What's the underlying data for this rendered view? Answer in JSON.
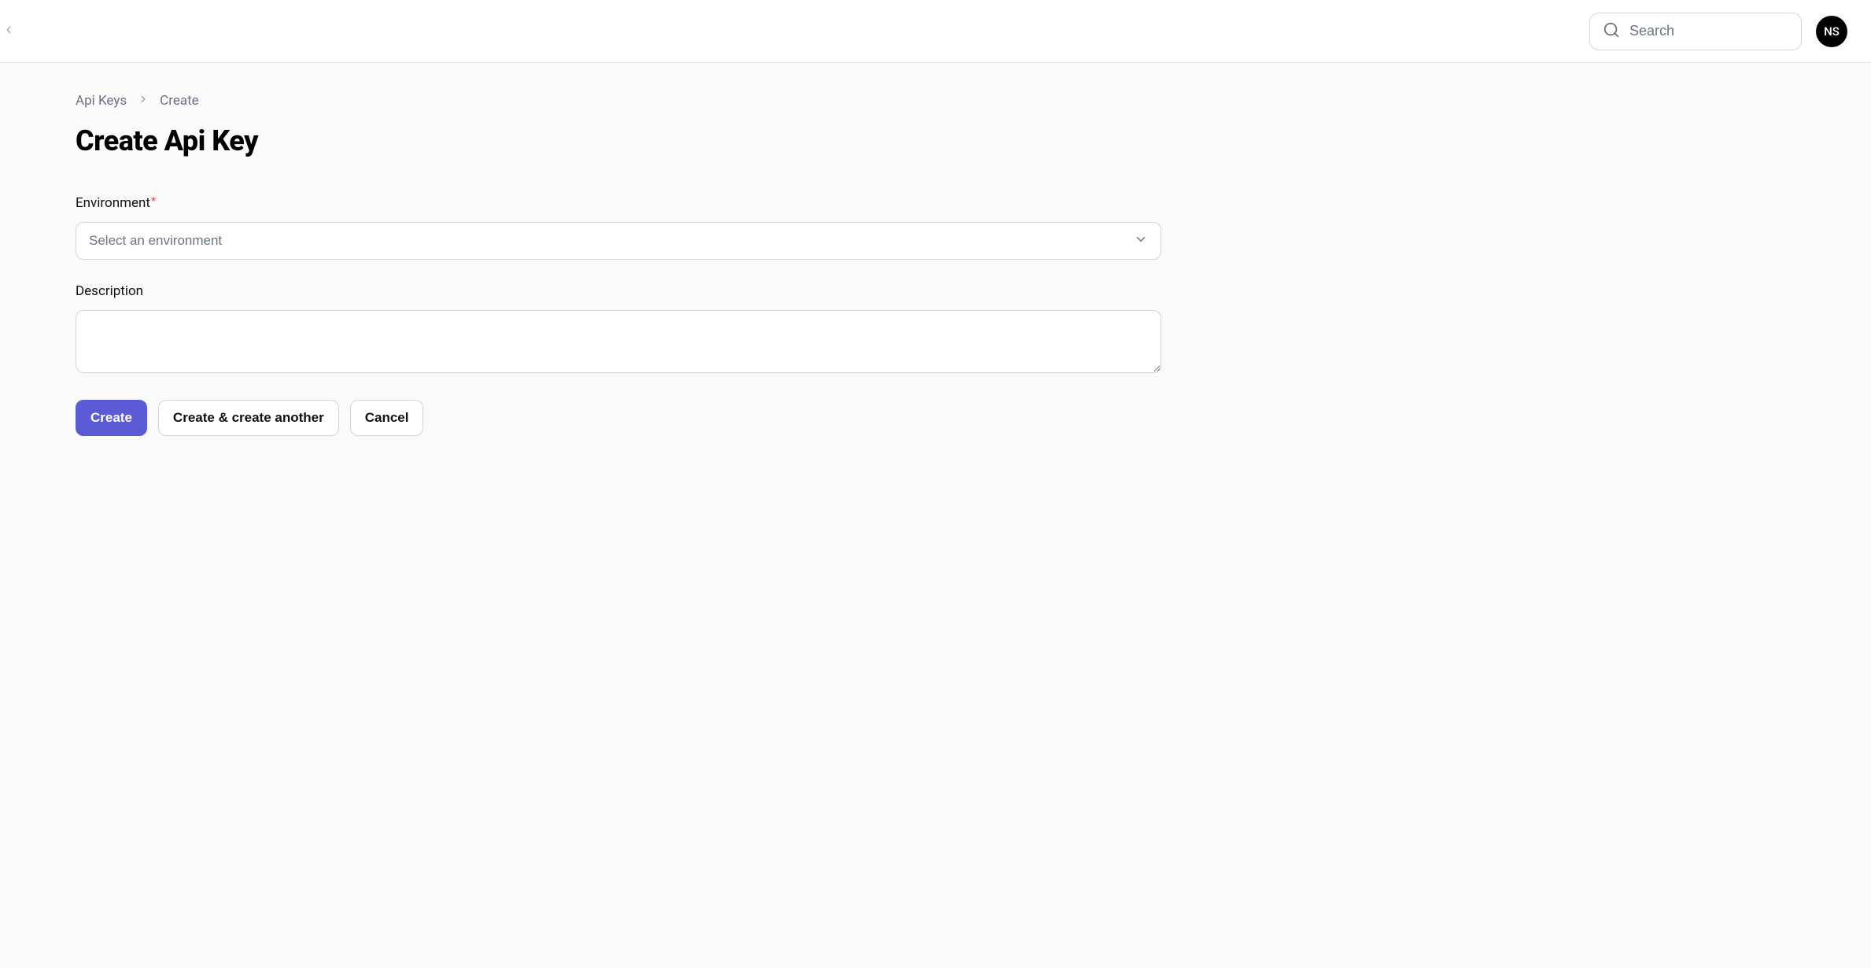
{
  "header": {
    "search_placeholder": "Search",
    "avatar_initials": "NS"
  },
  "breadcrumb": {
    "parent": "Api Keys",
    "current": "Create"
  },
  "page": {
    "title": "Create Api Key"
  },
  "form": {
    "environment": {
      "label": "Environment",
      "placeholder": "Select an environment",
      "required": true
    },
    "description": {
      "label": "Description",
      "value": ""
    }
  },
  "actions": {
    "create": "Create",
    "create_another": "Create & create another",
    "cancel": "Cancel"
  }
}
